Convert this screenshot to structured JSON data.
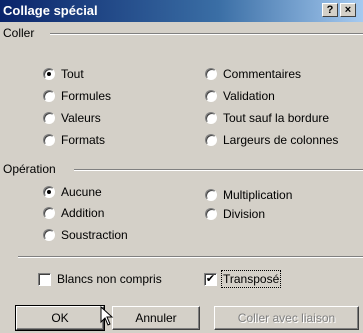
{
  "window": {
    "title": "Collage spécial",
    "help_label": "?",
    "close_label": "×"
  },
  "coller": {
    "label": "Coller",
    "options": [
      {
        "label": "Tout",
        "selected": true
      },
      {
        "label": "Formules",
        "selected": false
      },
      {
        "label": "Valeurs",
        "selected": false
      },
      {
        "label": "Formats",
        "selected": false
      },
      {
        "label": "Commentaires",
        "selected": false
      },
      {
        "label": "Validation",
        "selected": false
      },
      {
        "label": "Tout sauf la bordure",
        "selected": false
      },
      {
        "label": "Largeurs de colonnes",
        "selected": false
      }
    ]
  },
  "operation": {
    "label": "Opération",
    "options": [
      {
        "label": "Aucune",
        "selected": true
      },
      {
        "label": "Addition",
        "selected": false
      },
      {
        "label": "Soustraction",
        "selected": false
      },
      {
        "label": "Multiplication",
        "selected": false
      },
      {
        "label": "Division",
        "selected": false
      }
    ]
  },
  "checkboxes": {
    "blancs": {
      "label": "Blancs non compris",
      "checked": false
    },
    "transpose": {
      "label": "Transposé",
      "checked": true,
      "check_mark": "✔"
    }
  },
  "buttons": {
    "ok": "OK",
    "annuler": "Annuler",
    "coller_liaison": "Coller avec liaison"
  }
}
